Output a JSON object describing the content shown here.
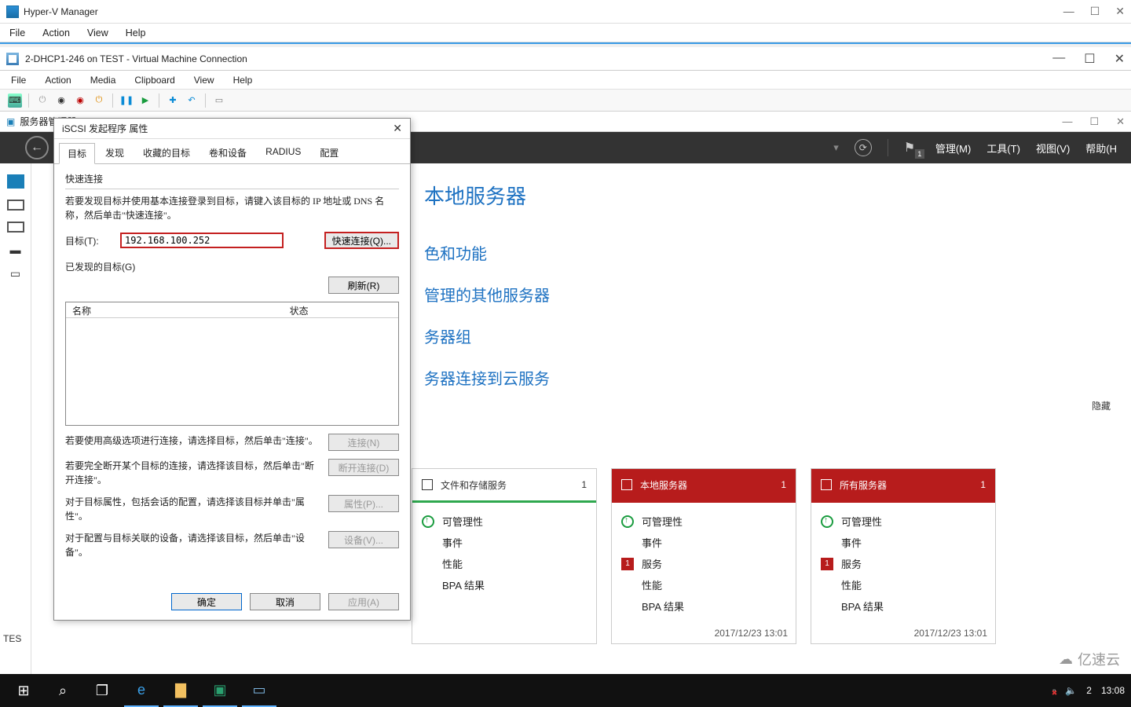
{
  "hv": {
    "title": "Hyper-V Manager",
    "menu": [
      "File",
      "Action",
      "View",
      "Help"
    ]
  },
  "vm": {
    "title": "2-DHCP1-246 on TEST - Virtual Machine Connection",
    "menu": [
      "File",
      "Action",
      "Media",
      "Clipboard",
      "View",
      "Help"
    ]
  },
  "sm": {
    "title": "服务器管理器",
    "header": {
      "manage": "管理(M)",
      "tools": "工具(T)",
      "view": "视图(V)",
      "help": "帮助(H",
      "flag_badge": "1"
    },
    "links": [
      "本地服务器",
      "色和功能",
      "管理的其他服务器",
      "务器组",
      "务器连接到云服务"
    ],
    "hide": "隐藏"
  },
  "dlg": {
    "title": "iSCSI 发起程序 属性",
    "tabs": [
      "目标",
      "发现",
      "收藏的目标",
      "卷和设备",
      "RADIUS",
      "配置"
    ],
    "quick_label": "快速连接",
    "quick_hint": "若要发现目标并使用基本连接登录到目标，请键入该目标的 IP 地址或 DNS 名称，然后单击\"快速连接\"。",
    "target_label": "目标(T):",
    "target_value": "192.168.100.252",
    "quick_btn": "快速连接(Q)...",
    "discovered_label": "已发现的目标(G)",
    "refresh_btn": "刷新(R)",
    "col_name": "名称",
    "col_state": "状态",
    "a1_text": "若要使用高级选项进行连接，请选择目标，然后单击\"连接\"。",
    "a1_btn": "连接(N)",
    "a2_text": "若要完全断开某个目标的连接，请选择该目标，然后单击\"断开连接\"。",
    "a2_btn": "断开连接(D)",
    "a3_text": "对于目标属性，包括会话的配置，请选择该目标并单击\"属性\"。",
    "a3_btn": "属性(P)...",
    "a4_text": "对于配置与目标关联的设备，请选择该目标，然后单击\"设备\"。",
    "a4_btn": "设备(V)...",
    "ok": "确定",
    "cancel": "取消",
    "apply": "应用(A)"
  },
  "cards": [
    {
      "title": "文件和存储服务",
      "count": "1",
      "color": "white",
      "rows": [
        {
          "t": "ok",
          "label": "可管理性"
        },
        {
          "t": "",
          "label": "事件"
        },
        {
          "t": "",
          "label": "性能"
        },
        {
          "t": "",
          "label": "BPA 结果"
        }
      ],
      "footer": ""
    },
    {
      "title": "本地服务器",
      "count": "1",
      "color": "red",
      "rows": [
        {
          "t": "ok",
          "label": "可管理性"
        },
        {
          "t": "",
          "label": "事件"
        },
        {
          "t": "err",
          "label": "服务"
        },
        {
          "t": "",
          "label": "性能"
        },
        {
          "t": "",
          "label": "BPA 结果"
        }
      ],
      "footer": "2017/12/23 13:01"
    },
    {
      "title": "所有服务器",
      "count": "1",
      "color": "red",
      "rows": [
        {
          "t": "ok",
          "label": "可管理性"
        },
        {
          "t": "",
          "label": "事件"
        },
        {
          "t": "err",
          "label": "服务"
        },
        {
          "t": "",
          "label": "性能"
        },
        {
          "t": "",
          "label": "BPA 结果"
        }
      ],
      "footer": "2017/12/23 13:01"
    }
  ],
  "taskbar": {
    "time": "13:08",
    "date": "2"
  },
  "watermark": "亿速云",
  "test": "TES"
}
